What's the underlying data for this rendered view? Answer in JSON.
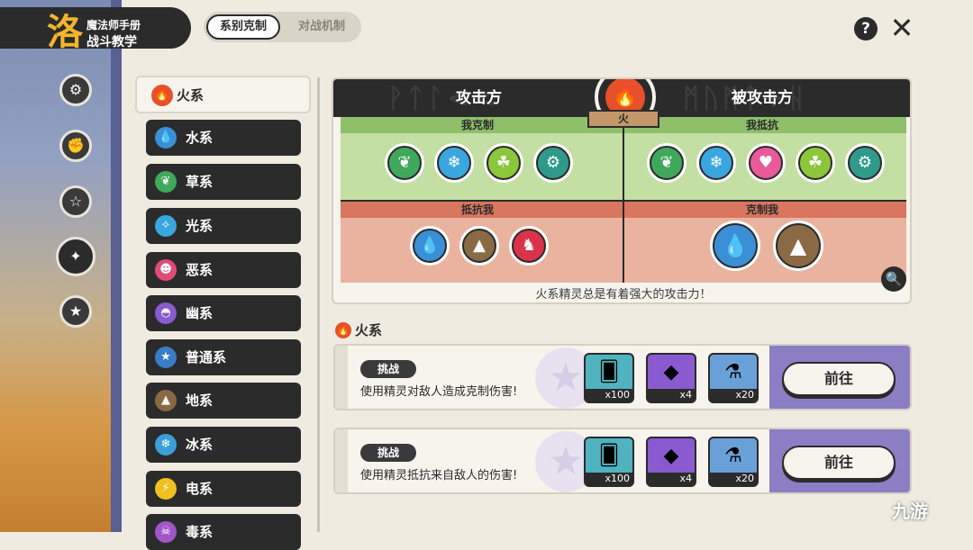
{
  "header": {
    "subtitle": "魔法师手册",
    "title": "战斗教学",
    "logo_glyph": "洛"
  },
  "tabs": [
    {
      "label": "系别克制"
    },
    {
      "label": "对战机制"
    }
  ],
  "controls": {
    "help": "?",
    "close": "✕"
  },
  "sidebar": {
    "icons": [
      "settings-gear-icon",
      "book-icon",
      "star-pouch-icon",
      "star-molecule-icon",
      "star-badge-icon"
    ],
    "active_index": 3
  },
  "types": [
    {
      "label": "火系",
      "icon": "fire-icon",
      "color": "#e8502b"
    },
    {
      "label": "水系",
      "icon": "water-drop-icon",
      "color": "#3a8fd6"
    },
    {
      "label": "草系",
      "icon": "leaf-icon",
      "color": "#3fa85a"
    },
    {
      "label": "光系",
      "icon": "sparkle-icon",
      "color": "#3aa6e0"
    },
    {
      "label": "恶系",
      "icon": "demon-icon",
      "color": "#e04a78"
    },
    {
      "label": "幽系",
      "icon": "ghost-icon",
      "color": "#8a5ad0"
    },
    {
      "label": "普通系",
      "icon": "star-icon",
      "color": "#3a7cc8"
    },
    {
      "label": "地系",
      "icon": "mountain-icon",
      "color": "#8a6a44"
    },
    {
      "label": "冰系",
      "icon": "snowflake-icon",
      "color": "#3a9fd8"
    },
    {
      "label": "电系",
      "icon": "lightning-icon",
      "color": "#f0c020"
    },
    {
      "label": "毒系",
      "icon": "poison-icon",
      "color": "#a055c8"
    }
  ],
  "chart": {
    "attacker_label": "攻击方",
    "defender_label": "被攻击方",
    "current_type": "火",
    "sections": {
      "i_counter": "我克制",
      "i_resist": "我抵抗",
      "resist_me": "抵抗我",
      "counter_me": "克制我"
    },
    "i_counter_icons": [
      "leaf-icon",
      "snowflake-icon",
      "bug-icon",
      "gear-icon"
    ],
    "i_resist_icons": [
      "leaf-icon",
      "snowflake-icon",
      "heart-icon",
      "bug-icon",
      "gear-icon"
    ],
    "resist_me_icons": [
      "water-drop-icon",
      "mountain-icon",
      "dragon-icon"
    ],
    "counter_me_icons": [
      "water-drop-icon",
      "mountain-icon"
    ],
    "caption": "火系精灵总是有着强大的攻击力！"
  },
  "section": {
    "title": "火系"
  },
  "tasks": [
    {
      "tag": "挑战",
      "desc": "使用精灵对敌人造成克制伤害!",
      "rewards": [
        {
          "icon": "card-icon",
          "qty": "x100"
        },
        {
          "icon": "gem-icon",
          "qty": "x4"
        },
        {
          "icon": "potion-icon",
          "qty": "x20"
        }
      ],
      "button": "前往"
    },
    {
      "tag": "挑战",
      "desc": "使用精灵抵抗来自敌人的伤害!",
      "rewards": [
        {
          "icon": "card-icon",
          "qty": "x100"
        },
        {
          "icon": "gem-icon",
          "qty": "x4"
        },
        {
          "icon": "potion-icon",
          "qty": "x20"
        }
      ],
      "button": "前往"
    }
  ],
  "watermark": "九游"
}
